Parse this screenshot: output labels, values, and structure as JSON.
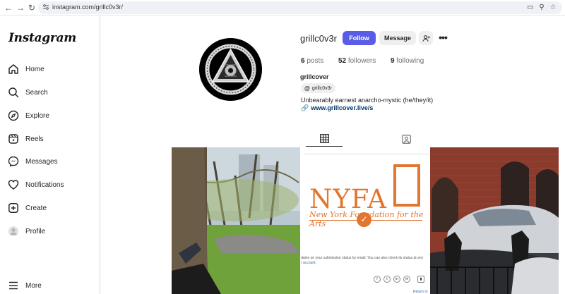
{
  "browser": {
    "url": "instagram.com/grillc0v3r/"
  },
  "sidebar": {
    "logo": "Instagram",
    "items": [
      {
        "label": "Home"
      },
      {
        "label": "Search"
      },
      {
        "label": "Explore"
      },
      {
        "label": "Reels"
      },
      {
        "label": "Messages"
      },
      {
        "label": "Notifications"
      },
      {
        "label": "Create"
      },
      {
        "label": "Profile"
      }
    ],
    "more": "More"
  },
  "profile": {
    "username": "grillc0v3r",
    "follow_label": "Follow",
    "message_label": "Message",
    "posts_count": "6",
    "posts_label": "posts",
    "followers_count": "52",
    "followers_label": "followers",
    "following_count": "9",
    "following_label": "following",
    "full_name": "grillcover",
    "threads_handle": "grillc0v3r",
    "bio": "Unbearably earnest anarcho-mystic (he/they/it)",
    "link": "www.grillcover.live/s"
  },
  "posts": {
    "nyfa_title": "NYFA",
    "nyfa_subtitle": "New York Foundation for the Arts",
    "nyfa_text": "dates on your submission status by email. You can also check its status at any",
    "nyfa_text2": "r account.",
    "nyfa_return": "Return to"
  },
  "colors": {
    "follow_button": "#5b5ce6",
    "link": "#00376b",
    "nyfa_orange": "#e2752f"
  }
}
